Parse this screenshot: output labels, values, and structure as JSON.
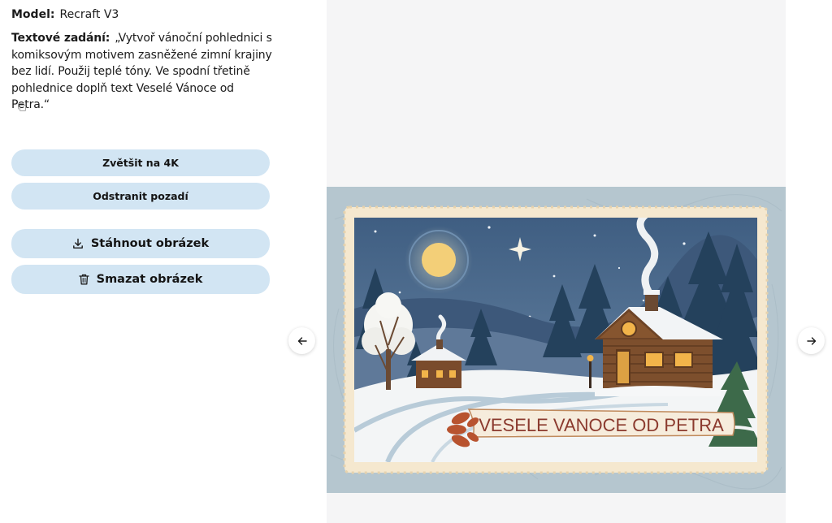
{
  "model": {
    "label": "Model:",
    "value": "Recraft V3"
  },
  "prompt": {
    "label": "Textové zadání:",
    "text": "„Vytvoř vánoční pohlednici s komiksovým motivem zasněžené zimní krajiny bez lidí. Použij teplé tóny. Ve spodní třetině pohlednice doplň text Veselé Vánoce od Petra.“"
  },
  "actions": {
    "upscale": "Zvětšit na 4K",
    "remove_bg": "Odstranit pozadí",
    "download": "Stáhnout obrázek",
    "delete": "Smazat obrázek"
  },
  "image": {
    "banner_text": "VESELE VANOCE OD PETRA"
  },
  "icons": {
    "copy": "copy-icon",
    "download": "download-icon",
    "trash": "trash-icon",
    "prev": "arrow-left-icon",
    "next": "arrow-right-icon"
  },
  "colors": {
    "button_bg": "#d2e5f3",
    "gallery_bg": "#f5f5f6",
    "postcard_sky": "#48688b",
    "postcard_border": "#f3e6cc",
    "banner_text": "#8b3a2e"
  }
}
